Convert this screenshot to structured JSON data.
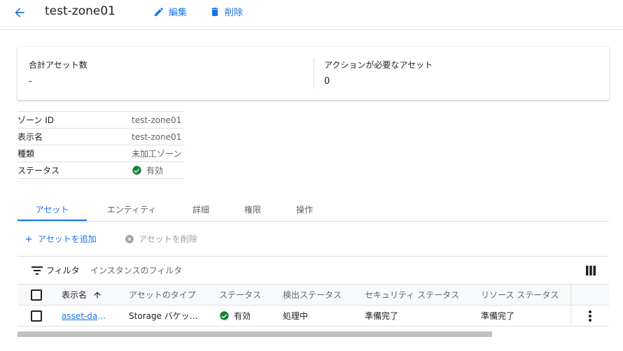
{
  "header": {
    "title": "test-zone01",
    "edit_label": "編集",
    "delete_label": "削除"
  },
  "summary": {
    "total_assets_label": "合計アセット数",
    "total_assets_value": "-",
    "action_needed_label": "アクションが必要なアセット",
    "action_needed_value": "0"
  },
  "details": [
    {
      "label": "ゾーン ID",
      "value": "test-zone01"
    },
    {
      "label": "表示名",
      "value": "test-zone01"
    },
    {
      "label": "種類",
      "value": "未加工ゾーン"
    },
    {
      "label": "ステータス",
      "value": "有効"
    }
  ],
  "tabs": [
    "アセット",
    "エンティティ",
    "詳細",
    "権限",
    "操作"
  ],
  "actions": {
    "add_label": "アセットを追加",
    "delete_label": "アセットを削除"
  },
  "filter": {
    "label": "フィルタ",
    "placeholder": "インスタンスのフィルタ"
  },
  "table": {
    "columns": [
      "表示名",
      "アセットのタイプ",
      "ステータス",
      "検出ステータス",
      "セキュリティ ステータス",
      "リソース ステータス"
    ],
    "rows": [
      {
        "display_name": "asset-dat…",
        "asset_type": "Storage バケッ…",
        "status": "有効",
        "discovery_status": "処理中",
        "security_status": "準備完了",
        "resource_status": "準備完了"
      }
    ]
  },
  "colors": {
    "accent": "#1a73e8",
    "success": "#188038",
    "disabled": "#9aa0a6"
  }
}
